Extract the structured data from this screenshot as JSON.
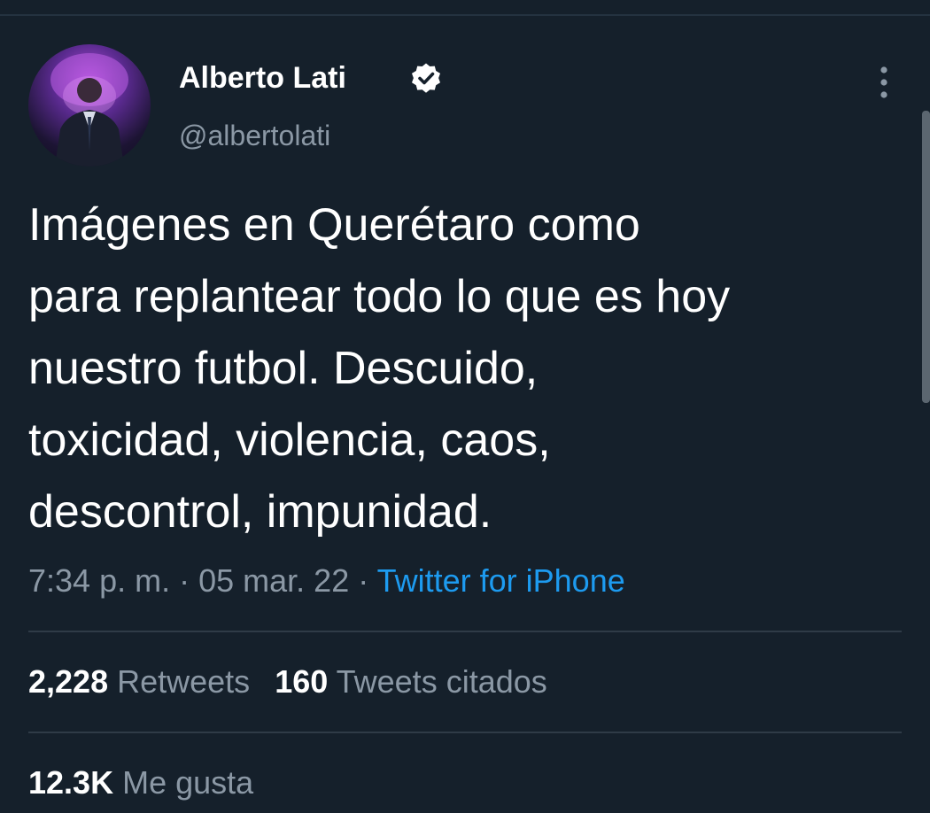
{
  "tweet": {
    "author": {
      "display_name": "Alberto Lati",
      "handle": "@albertolati",
      "verified": true
    },
    "text_lines": [
      "Imágenes en Querétaro como",
      "para replantear todo lo que es hoy",
      "nuestro futbol. Descuido,",
      "toxicidad, violencia, caos,",
      "descontrol, impunidad."
    ],
    "time": "7:34 p. m.",
    "separator": "·",
    "date": "05 mar. 22",
    "source": "Twitter for iPhone"
  },
  "stats": {
    "retweets_count": "2,228",
    "retweets_label": "Retweets",
    "quotes_count": "160",
    "quotes_label": "Tweets citados",
    "likes_count": "12.3K",
    "likes_label": "Me gusta"
  },
  "colors": {
    "background": "#15202b",
    "accent": "#1d9bf0",
    "secondary_text": "#8b98a5"
  },
  "icons": {
    "verified": "verified-badge-icon",
    "more": "more-vertical-icon"
  }
}
